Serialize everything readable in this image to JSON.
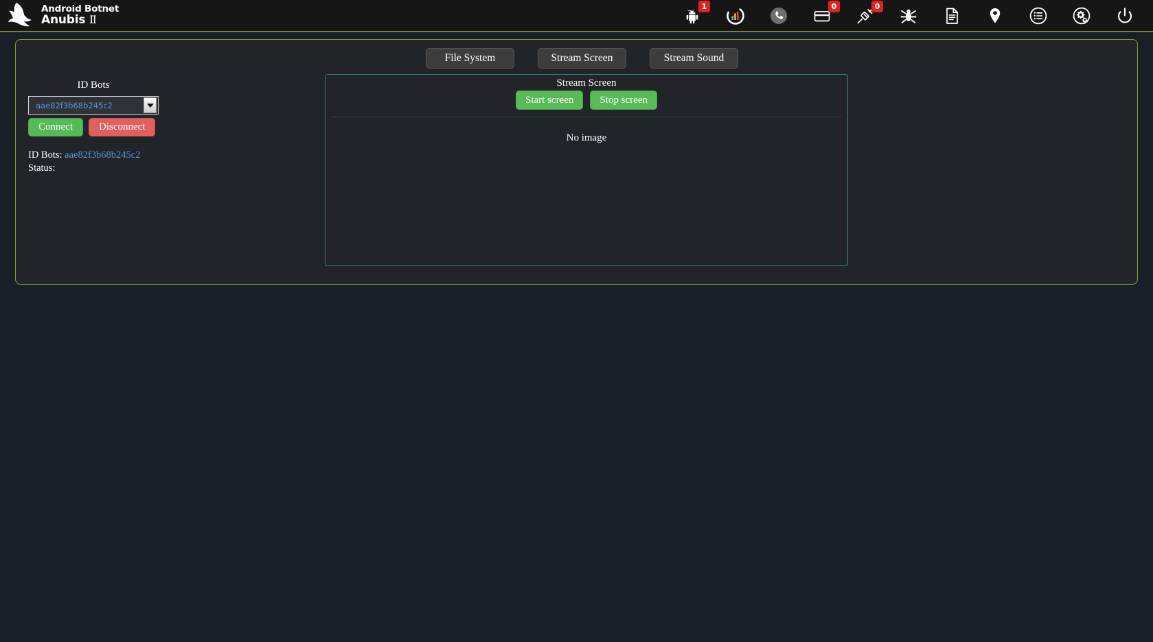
{
  "brand": {
    "line1": "Android Botnet",
    "line2": "Anubis",
    "numeral": "Ⅱ",
    "logo_icon": "anubis-jackal-logo"
  },
  "nav_icons": [
    {
      "name": "android-icon",
      "badge": "1"
    },
    {
      "name": "statistics-icon",
      "badge": null
    },
    {
      "name": "phone-icon",
      "badge": null
    },
    {
      "name": "credit-card-icon",
      "badge": "0"
    },
    {
      "name": "injector-icon",
      "badge": "0"
    },
    {
      "name": "bug-icon",
      "badge": null
    },
    {
      "name": "document-icon",
      "badge": null
    },
    {
      "name": "location-pin-icon",
      "badge": null
    },
    {
      "name": "logs-icon",
      "badge": null
    },
    {
      "name": "settings-icon",
      "badge": null
    },
    {
      "name": "power-icon",
      "badge": null
    }
  ],
  "tabs": [
    {
      "label": "File System"
    },
    {
      "label": "Stream Screen"
    },
    {
      "label": "Stream Sound"
    }
  ],
  "left_panel": {
    "id_bots_label": "ID Bots",
    "selected_bot": "aae82f3b68b245c2",
    "connect_label": "Connect",
    "disconnect_label": "Disconnect",
    "status": {
      "id_bots_prefix": "ID Bots:",
      "id_bots_value": "aae82f3b68b245c2",
      "status_prefix": "Status:",
      "status_value": ""
    }
  },
  "stream_panel": {
    "title": "Stream Screen",
    "start_label": "Start screen",
    "stop_label": "Stop screen",
    "placeholder": "No image"
  },
  "colors": {
    "page_background": "#191f27",
    "header_background": "#161616",
    "accent_border": "#84a232",
    "panel_border": "#3f7a80",
    "green_button": "#58bb58",
    "red_button": "#e06060",
    "badge_red": "#e02222",
    "link_blue": "#5c93d6"
  }
}
